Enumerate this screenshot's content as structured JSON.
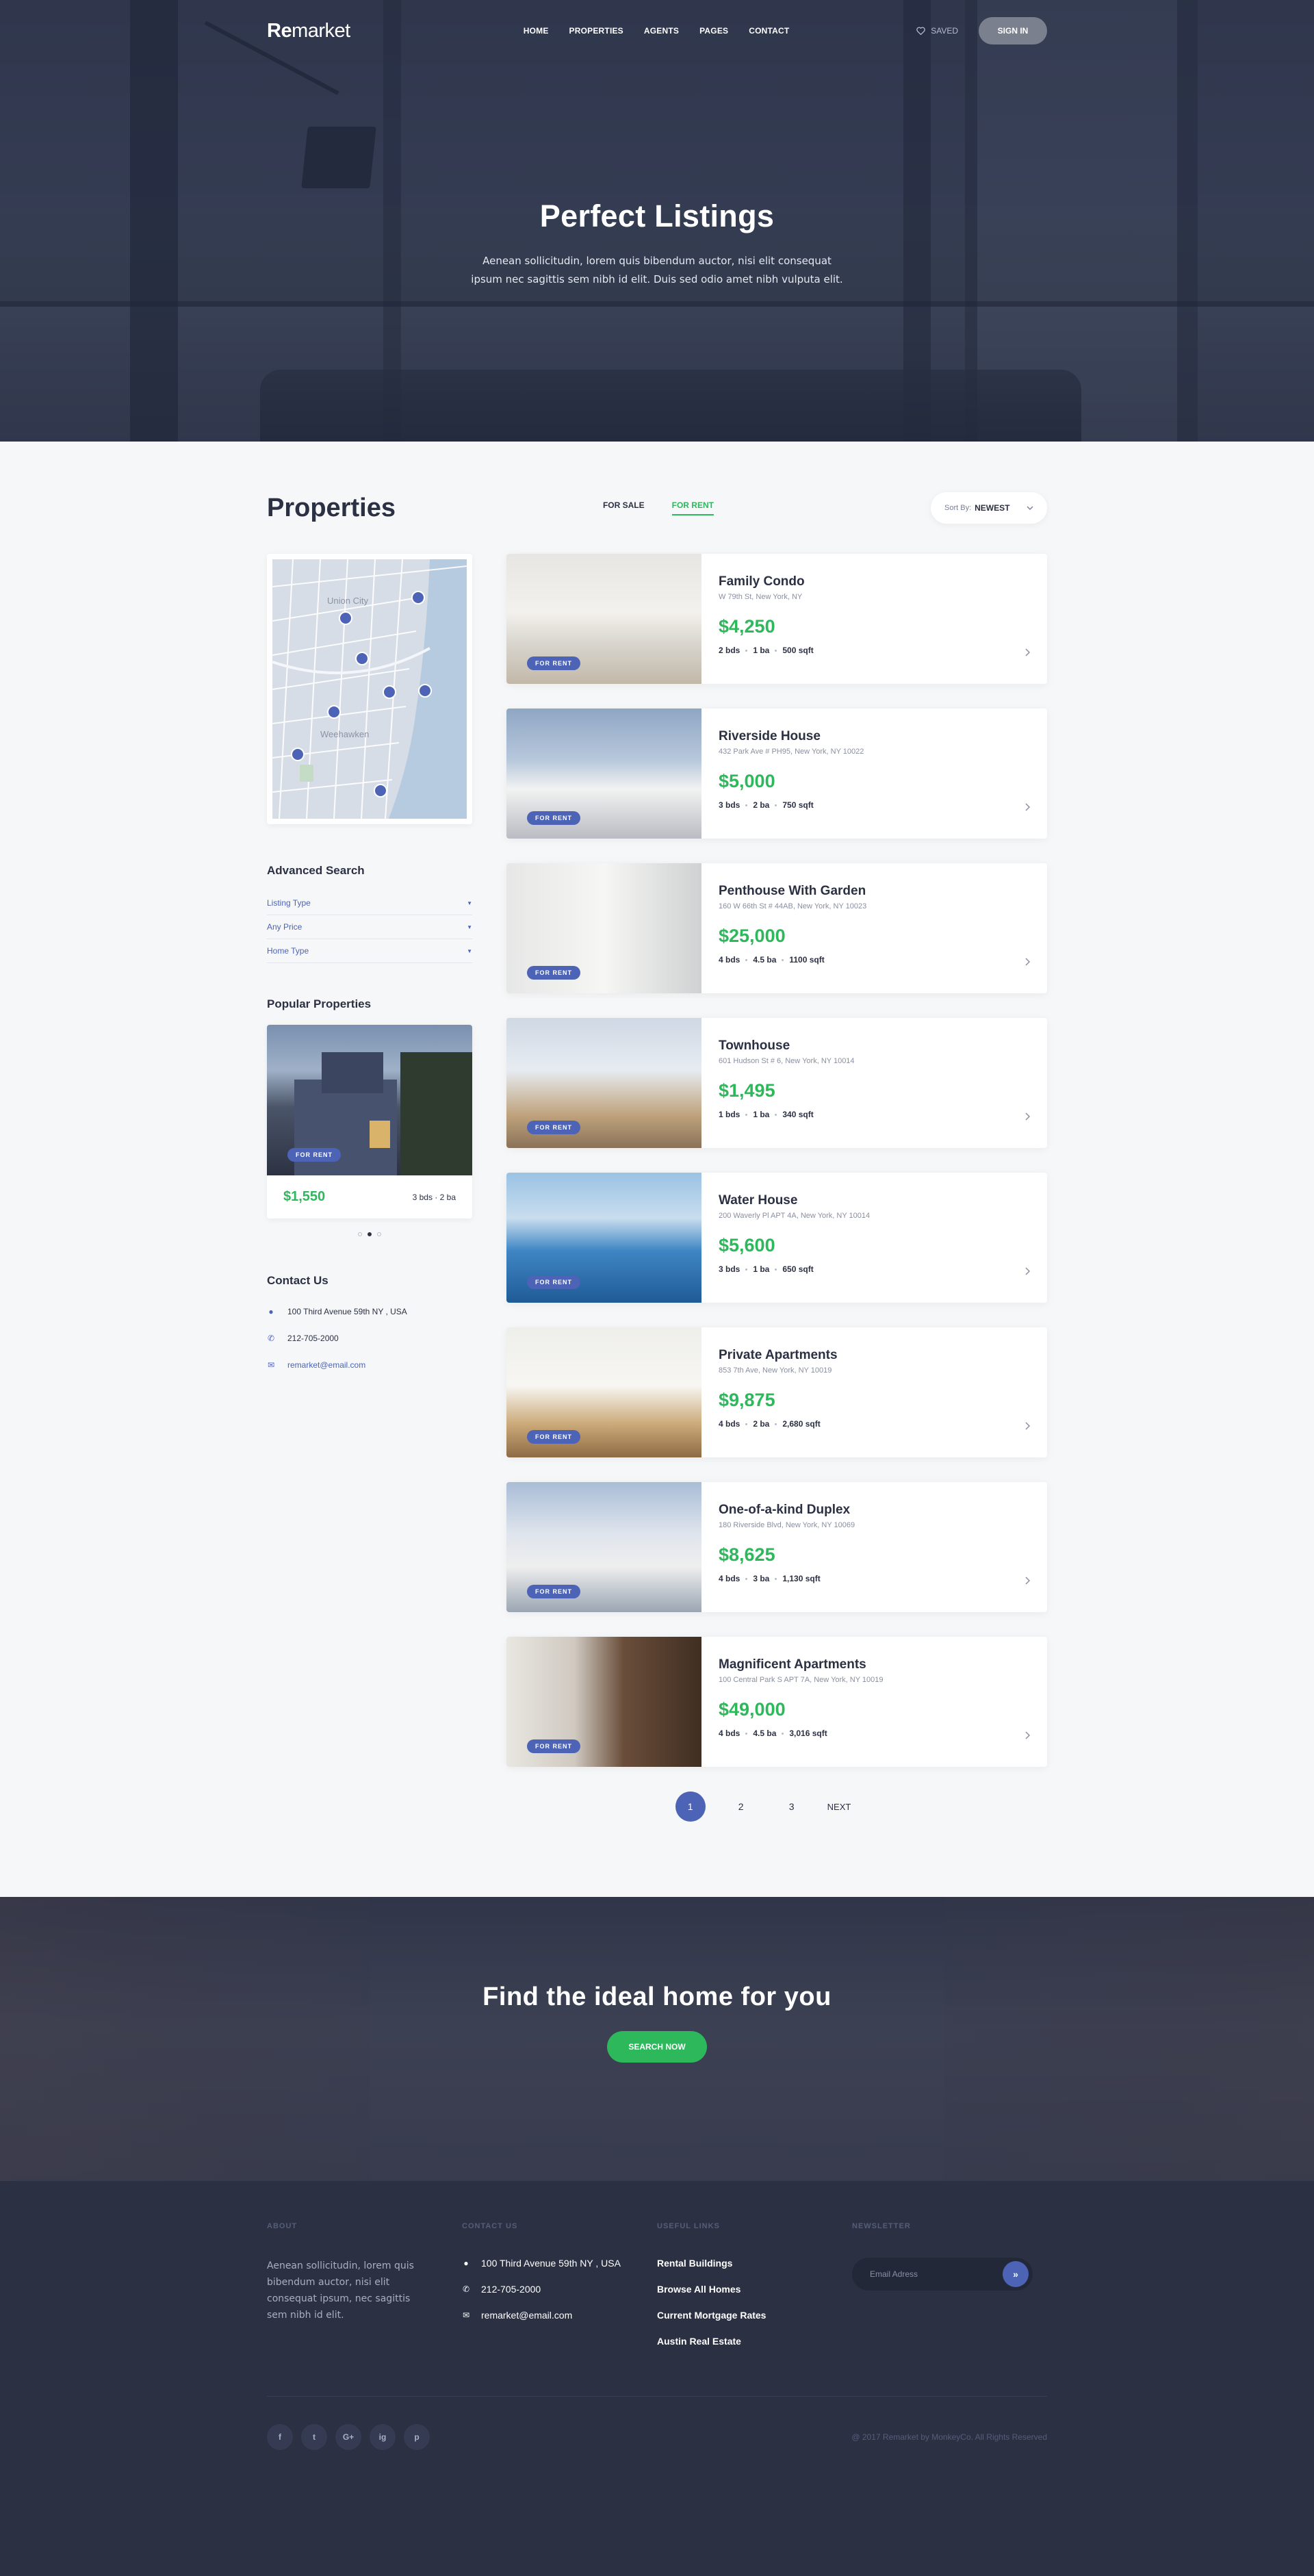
{
  "brand": {
    "logo_bold": "Re",
    "logo_rest": "market"
  },
  "nav": {
    "items": [
      "HOME",
      "PROPERTIES",
      "AGENTS",
      "PAGES",
      "CONTACT"
    ],
    "saved_label": "SAVED",
    "signin_label": "SIGN IN"
  },
  "hero": {
    "title": "Perfect Listings",
    "text": "Aenean sollicitudin, lorem quis bibendum auctor, nisi elit consequat ipsum nec sagittis sem nibh id elit. Duis sed odio amet nibh vulputa elit."
  },
  "properties": {
    "title": "Properties",
    "tabs": [
      "FOR SALE",
      "FOR RENT"
    ],
    "active_tab": "FOR RENT",
    "sort_label": "Sort By:",
    "sort_value": "NEWEST"
  },
  "sidebar": {
    "map_label": "Union City",
    "map_label_2": "Weehawken",
    "search_title": "Advanced Search",
    "filters": [
      "Listing Type",
      "Any Price",
      "Home Type"
    ],
    "popular_title": "Popular Properties",
    "popular": {
      "badge": "FOR RENT",
      "price": "$1,550",
      "beds": "3 bds",
      "baths": "2 ba"
    },
    "contact_title": "Contact Us",
    "contact": {
      "address": "100 Third Avenue 59th NY , USA",
      "phone": "212-705-2000",
      "email": "remarket@email.com"
    }
  },
  "listings": [
    {
      "title": "Family Condo",
      "address": "W 79th St, New York, NY",
      "price": "$4,250",
      "beds": "2 bds",
      "baths": "1 ba",
      "area": "500 sqft",
      "badge": "FOR RENT"
    },
    {
      "title": "Riverside House",
      "address": "432 Park Ave # PH95, New York, NY 10022",
      "price": "$5,000",
      "beds": "3 bds",
      "baths": "2 ba",
      "area": "750 sqft",
      "badge": "FOR RENT"
    },
    {
      "title": "Penthouse With Garden",
      "address": "160 W 66th St # 44AB, New York, NY 10023",
      "price": "$25,000",
      "beds": "4 bds",
      "baths": "4.5 ba",
      "area": "1100 sqft",
      "badge": "FOR RENT"
    },
    {
      "title": "Townhouse",
      "address": "601 Hudson St # 6, New York, NY 10014",
      "price": "$1,495",
      "beds": "1 bds",
      "baths": "1 ba",
      "area": "340 sqft",
      "badge": "FOR RENT"
    },
    {
      "title": "Water House",
      "address": "200 Waverly Pl APT 4A, New York, NY 10014",
      "price": "$5,600",
      "beds": "3 bds",
      "baths": "1 ba",
      "area": "650 sqft",
      "badge": "FOR RENT"
    },
    {
      "title": "Private Apartments",
      "address": "853 7th Ave, New York, NY 10019",
      "price": "$9,875",
      "beds": "4 bds",
      "baths": "2 ba",
      "area": "2,680 sqft",
      "badge": "FOR RENT"
    },
    {
      "title": "One-of-a-kind Duplex",
      "address": "180 Riverside Blvd, New York, NY 10069",
      "price": "$8,625",
      "beds": "4 bds",
      "baths": "3 ba",
      "area": "1,130 sqft",
      "badge": "FOR RENT"
    },
    {
      "title": "Magnificent Apartments",
      "address": "100 Central Park S APT 7A, New York, NY 10019",
      "price": "$49,000",
      "beds": "4 bds",
      "baths": "4.5 ba",
      "area": "3,016 sqft",
      "badge": "FOR RENT"
    }
  ],
  "pagination": {
    "pages": [
      "1",
      "2",
      "3"
    ],
    "active": "1",
    "next_label": "NEXT"
  },
  "cta": {
    "title": "Find the ideal home for you",
    "button": "SEARCH NOW"
  },
  "footer": {
    "about_title": "ABOUT",
    "about_text": "Aenean sollicitudin, lorem quis bibendum auctor, nisi elit consequat ipsum, nec sagittis sem nibh id elit.",
    "contact_title": "CONTACT US",
    "address": "100 Third Avenue 59th NY , USA",
    "phone": "212-705-2000",
    "email": "remarket@email.com",
    "links_title": "USEFUL LINKS",
    "links": [
      "Rental Buildings",
      "Browse All Homes",
      "Current Mortgage Rates",
      "Austin Real Estate"
    ],
    "newsletter_title": "NEWSLETTER",
    "newsletter_placeholder": "Email Adress",
    "social": [
      "f",
      "t",
      "G+",
      "ig",
      "p"
    ],
    "copyright": "@ 2017 Remarket by MonkeyCo. All Rights Reserved"
  },
  "colors": {
    "accent_green": "#2eb85c",
    "accent_blue": "#4c63b6",
    "dark": "#2b3043"
  },
  "icons": {
    "saved": "heart-icon",
    "sort": "chevron-down-icon",
    "card": "chevron-right-icon",
    "newsletter": "double-chevron-right-icon"
  }
}
